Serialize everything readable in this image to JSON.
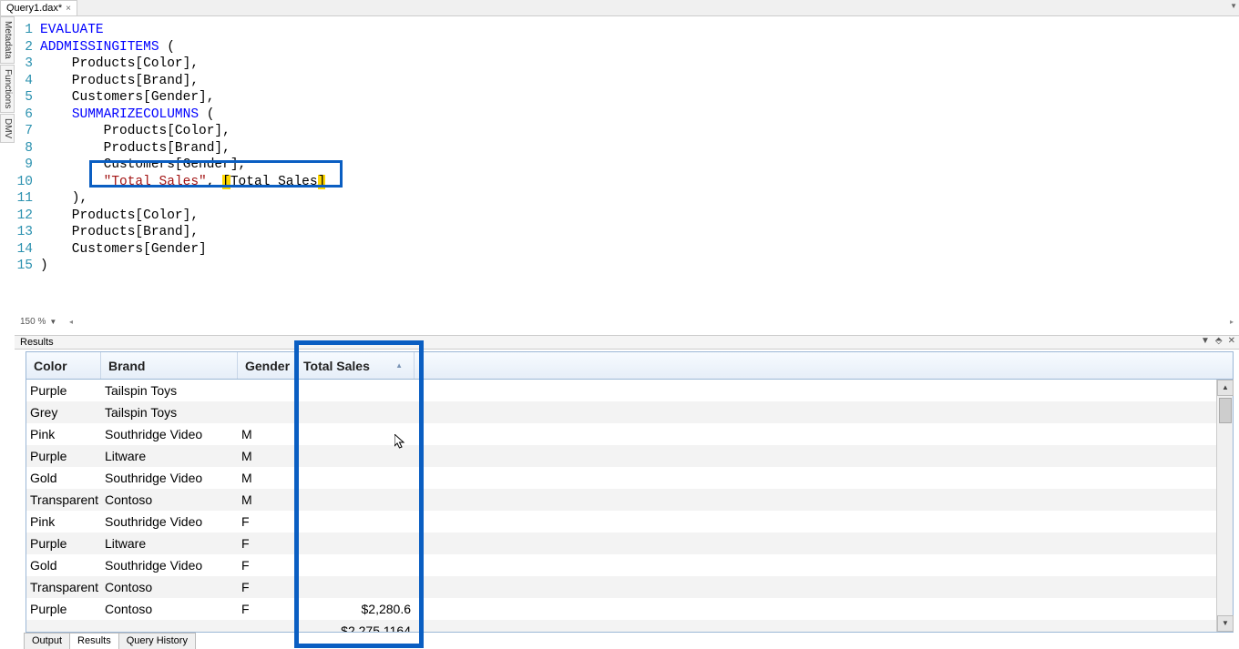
{
  "tab": {
    "title": "Query1.dax*",
    "close": "×"
  },
  "sidetabs": [
    "Metadata",
    "Functions",
    "DMV"
  ],
  "zoom": "150 %",
  "code": {
    "l1": {
      "n": "1",
      "pre": "",
      "kw": "EVALUATE",
      "rest": ""
    },
    "l2": {
      "n": "2",
      "pre": "",
      "kw": "ADDMISSINGITEMS",
      "rest": " ("
    },
    "l3": {
      "n": "3",
      "txt": "    Products[Color],"
    },
    "l4": {
      "n": "4",
      "txt": "    Products[Brand],"
    },
    "l5": {
      "n": "5",
      "txt": "    Customers[Gender],"
    },
    "l6": {
      "n": "6",
      "pre": "    ",
      "kw": "SUMMARIZECOLUMNS",
      "rest": " ("
    },
    "l7": {
      "n": "7",
      "txt": "        Products[Color],"
    },
    "l8": {
      "n": "8",
      "txt": "        Products[Brand],"
    },
    "l9": {
      "n": "9",
      "txt": "        Customers[Gender],"
    },
    "l10": {
      "n": "10",
      "indent": "        ",
      "str": "\"Total Sales\"",
      "mid": ", ",
      "b1": "[",
      "meas": "Total Sales",
      "b2": "]"
    },
    "l11": {
      "n": "11",
      "txt": "    ),"
    },
    "l12": {
      "n": "12",
      "txt": "    Products[Color],"
    },
    "l13": {
      "n": "13",
      "txt": "    Products[Brand],"
    },
    "l14": {
      "n": "14",
      "txt": "    Customers[Gender]"
    },
    "l15": {
      "n": "15",
      "txt": ")"
    }
  },
  "results": {
    "title": "Results",
    "headers": {
      "c1": "Color",
      "c2": "Brand",
      "c3": "Gender",
      "c4": "Total Sales"
    },
    "rows": [
      {
        "c1": "Purple",
        "c2": "Tailspin Toys",
        "c3": "",
        "c4": ""
      },
      {
        "c1": "Grey",
        "c2": "Tailspin Toys",
        "c3": "",
        "c4": ""
      },
      {
        "c1": "Pink",
        "c2": "Southridge Video",
        "c3": "M",
        "c4": ""
      },
      {
        "c1": "Purple",
        "c2": "Litware",
        "c3": "M",
        "c4": ""
      },
      {
        "c1": "Gold",
        "c2": "Southridge Video",
        "c3": "M",
        "c4": ""
      },
      {
        "c1": "Transparent",
        "c2": "Contoso",
        "c3": "M",
        "c4": ""
      },
      {
        "c1": "Pink",
        "c2": "Southridge Video",
        "c3": "F",
        "c4": ""
      },
      {
        "c1": "Purple",
        "c2": "Litware",
        "c3": "F",
        "c4": ""
      },
      {
        "c1": "Gold",
        "c2": "Southridge Video",
        "c3": "F",
        "c4": ""
      },
      {
        "c1": "Transparent",
        "c2": "Contoso",
        "c3": "F",
        "c4": ""
      },
      {
        "c1": "Purple",
        "c2": "Contoso",
        "c3": "F",
        "c4": "$2,280.6"
      },
      {
        "c1": "",
        "c2": "",
        "c3": "",
        "c4": "$2,275.1164"
      }
    ]
  },
  "bottomTabs": {
    "t1": "Output",
    "t2": "Results",
    "t3": "Query History"
  },
  "colWidths": {
    "c1": 82,
    "c2": 150,
    "c3": 64,
    "c4": 130
  },
  "icons": {
    "dropdown": "▼",
    "pin": "⬘",
    "close": "✕",
    "up": "▲",
    "down": "▼",
    "left": "◂",
    "right": "▸"
  }
}
